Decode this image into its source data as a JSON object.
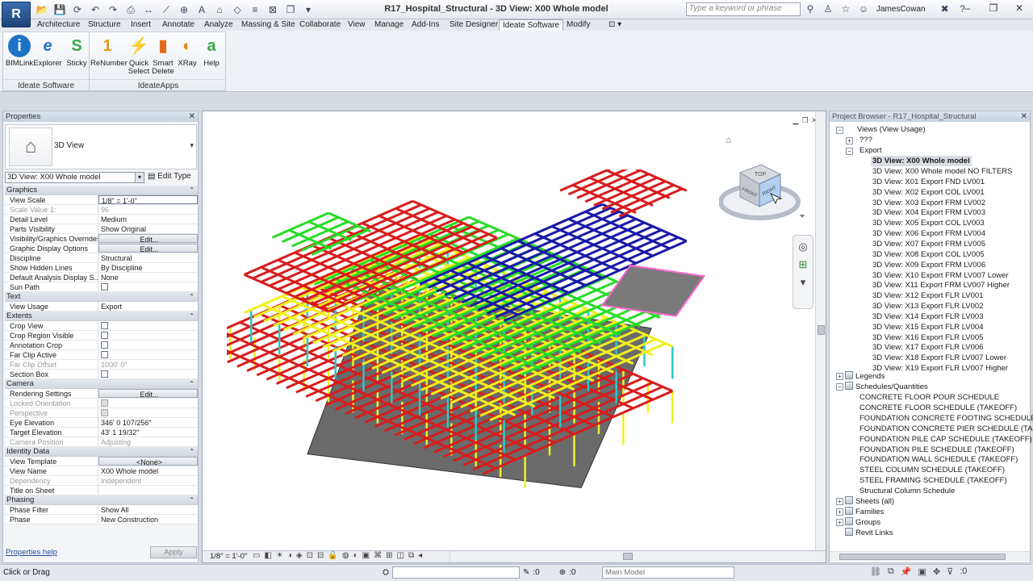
{
  "app": {
    "logo": "R",
    "window_title": "R17_Hospital_Structural - 3D View: X00 Whole model",
    "search_placeholder": "Type a keyword or phrase",
    "user": "JamesCowan",
    "minimize": "–",
    "restore": "❐",
    "close": "✕"
  },
  "ribbon_tabs": [
    "Architecture",
    "Structure",
    "Insert",
    "Annotate",
    "Analyze",
    "Massing & Site",
    "Collaborate",
    "View",
    "Manage",
    "Add-Ins",
    "Site Designer",
    "Ideate Software",
    "Modify"
  ],
  "active_tab": "Ideate Software",
  "ribbon": {
    "panel_software": "Ideate Software",
    "panel_apps": "IdeateApps",
    "buttons": [
      {
        "label": "BIMLink",
        "icon": "i",
        "color": "#1f73c7"
      },
      {
        "label": "Explorer",
        "icon": "e",
        "color": "#1f73c7"
      },
      {
        "label": "Sticky",
        "icon": "S",
        "color": "#3aa64a"
      },
      {
        "label": "ReNumber",
        "icon": "1",
        "color": "#e39a1c"
      },
      {
        "label": "Quick Select",
        "icon": "⚡",
        "color": "#e37a1c"
      },
      {
        "label": "Smart Delete",
        "icon": "▮",
        "color": "#e36a1c"
      },
      {
        "label": "XRay",
        "icon": "◐",
        "color": "#e3861c"
      },
      {
        "label": "Help",
        "icon": "a",
        "color": "#3aa64a"
      }
    ]
  },
  "properties": {
    "title": "Properties",
    "type_name": "3D View",
    "instance": "3D View: X00 Whole model",
    "edit_type": "Edit Type",
    "help": "Properties help",
    "apply": "Apply",
    "rows": [
      {
        "section": "Graphics"
      },
      {
        "k": "View Scale",
        "v": "1/8\" = 1'-0\"",
        "style": "boxed"
      },
      {
        "k": "Scale Value    1:",
        "v": "96",
        "dim": true
      },
      {
        "k": "Detail Level",
        "v": "Medium"
      },
      {
        "k": "Parts Visibility",
        "v": "Show Original"
      },
      {
        "k": "Visibility/Graphics Overrides",
        "v": "Edit...",
        "style": "btn"
      },
      {
        "k": "Graphic Display Options",
        "v": "Edit...",
        "style": "btn"
      },
      {
        "k": "Discipline",
        "v": "Structural"
      },
      {
        "k": "Show Hidden Lines",
        "v": "By Discipline"
      },
      {
        "k": "Default Analysis Display S...",
        "v": "None"
      },
      {
        "k": "Sun Path",
        "v": "",
        "check": true
      },
      {
        "section": "Text"
      },
      {
        "k": "View Usage",
        "v": "Export"
      },
      {
        "section": "Extents"
      },
      {
        "k": "Crop View",
        "v": "",
        "check": true
      },
      {
        "k": "Crop Region Visible",
        "v": "",
        "check": true
      },
      {
        "k": "Annotation Crop",
        "v": "",
        "check": true
      },
      {
        "k": "Far Clip Active",
        "v": "",
        "check": true
      },
      {
        "k": "Far Clip Offset",
        "v": "1000'  0\"",
        "dim": true
      },
      {
        "k": "Section Box",
        "v": "",
        "check": true
      },
      {
        "section": "Camera"
      },
      {
        "k": "Rendering Settings",
        "v": "Edit...",
        "style": "btn"
      },
      {
        "k": "Locked Orientation",
        "v": "",
        "check": true,
        "dim": true
      },
      {
        "k": "Perspective",
        "v": "",
        "check": true,
        "dim": true
      },
      {
        "k": "Eye Elevation",
        "v": "346'  0 107/256\""
      },
      {
        "k": "Target Elevation",
        "v": "43'  1 19/32\""
      },
      {
        "k": "Camera Position",
        "v": "Adjusting",
        "dim": true
      },
      {
        "section": "Identity Data"
      },
      {
        "k": "View Template",
        "v": "<None>",
        "style": "btn"
      },
      {
        "k": "View Name",
        "v": "X00 Whole model"
      },
      {
        "k": "Dependency",
        "v": "Independent",
        "dim": true
      },
      {
        "k": "Title on Sheet",
        "v": ""
      },
      {
        "section": "Phasing"
      },
      {
        "k": "Phase Filter",
        "v": "Show All"
      },
      {
        "k": "Phase",
        "v": "New Construction"
      }
    ]
  },
  "viewport": {
    "scale": "1/8\" = 1'-0\"",
    "cube_top": "TOP",
    "cube_front": "FRONT",
    "cube_right": "RIGHT"
  },
  "browser": {
    "title": "Project Browser - R17_Hospital_Structural",
    "views_root": "Views (View Usage)",
    "unknown": "???",
    "export": "Export",
    "selected": "3D View: X00 Whole model",
    "views": [
      "3D View: X00 Whole model NO FILTERS",
      "3D View: X01 Export FND LV001",
      "3D View: X02 Export COL LV001",
      "3D View: X03 Export FRM LV002",
      "3D View: X04 Export FRM LV003",
      "3D View: X05 Export COL LV003",
      "3D View: X06 Export FRM LV004",
      "3D View: X07 Export FRM LV005",
      "3D View: X08 Export COL LV005",
      "3D View: X09 Export FRM LV006",
      "3D View: X10 Export FRM LV007 Lower",
      "3D View: X11 Export FRM LV007 Higher",
      "3D View: X12 Export FLR LV001",
      "3D View: X13 Export FLR LV002",
      "3D View: X14 Export FLR LV003",
      "3D View: X15 Export FLR LV004",
      "3D View: X16 Export FLR LV005",
      "3D View: X17 Export FLR LV006",
      "3D View: X18 Export FLR LV007 Lower",
      "3D View: X19 Export FLR LV007 Higher"
    ],
    "legends": "Legends",
    "schedules": "Schedules/Quantities",
    "schedule_items": [
      "CONCRETE FLOOR POUR SCHEDULE",
      "CONCRETE FLOOR SCHEDULE (TAKEOFF)",
      "FOUNDATION CONCRETE FOOTING SCHEDULE (TAK",
      "FOUNDATION CONCRETE PIER SCHEDULE (TAKEOF",
      "FOUNDATION PILE CAP SCHEDULE (TAKEOFF)",
      "FOUNDATION PILE SCHEDULE (TAKEOFF)",
      "FOUNDATION WALL SCHEDULE (TAKEOFF)",
      "STEEL COLUMN SCHEDULE (TAKEOFF)",
      "STEEL FRAMING SCHEDULE (TAKEOFF)",
      "Structural Column Schedule"
    ],
    "sheets": "Sheets (all)",
    "families": "Families",
    "groups": "Groups",
    "links": "Revit Links"
  },
  "status": {
    "text": "Click or Drag",
    "count1": ":0",
    "count2": ":0",
    "main_model": "Main Model"
  },
  "colors": {
    "level1": "#d81c1c",
    "level2": "#f0f020",
    "level3": "#28dc28",
    "level4": "#1a1aa8",
    "column": "#28c8c8",
    "slab": "#6a6a6a",
    "roof": "#7a7a7a",
    "roof_edge": "#ff66cc"
  }
}
